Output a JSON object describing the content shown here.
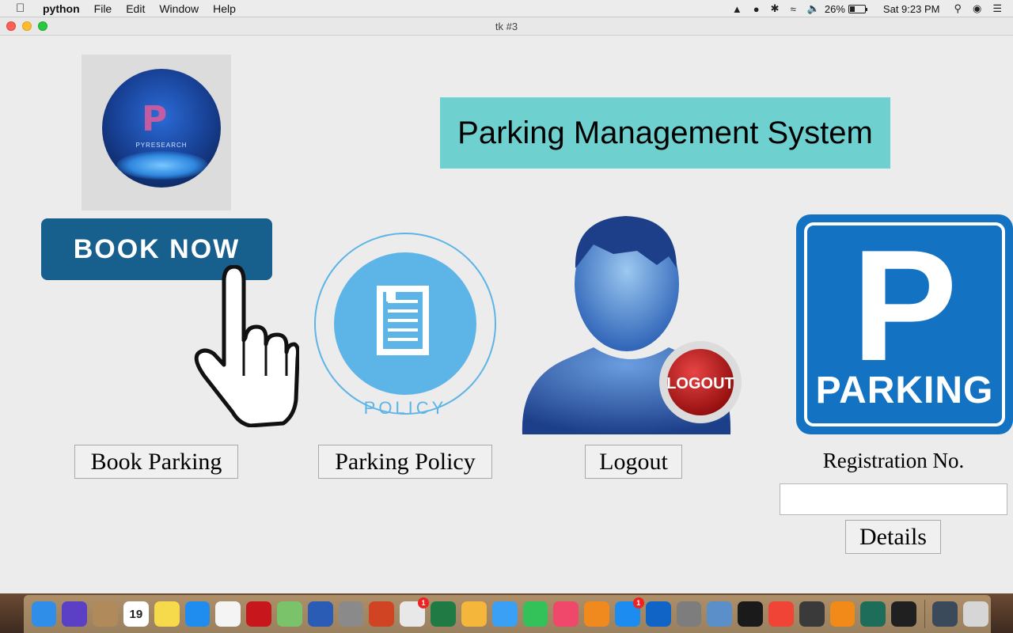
{
  "menubar": {
    "app_name": "python",
    "items": [
      "File",
      "Edit",
      "Window",
      "Help"
    ],
    "battery_percent": "26%",
    "clock": "Sat 9:23 PM"
  },
  "window": {
    "title": "tk #3"
  },
  "main": {
    "title": "Parking Management System",
    "logo_text": "PYRESEARCH",
    "book_now_label": "BOOK NOW",
    "policy_icon_text": "POLICY",
    "logout_badge_text": "LOGOUT",
    "parking_sign_text": "PARKING",
    "parking_sign_letter": "P",
    "buttons": {
      "book_parking": "Book Parking",
      "parking_policy": "Parking Policy",
      "logout": "Logout",
      "details": "Details"
    },
    "registration_label": "Registration No.",
    "registration_value": ""
  },
  "dock": {
    "calendar_day": "19",
    "appstore_badge": "1",
    "chrome_badge": "1",
    "icons": [
      {
        "name": "finder-icon",
        "color": "#2f8fe8"
      },
      {
        "name": "siri-icon",
        "color": "#5b3fc4"
      },
      {
        "name": "contacts-icon",
        "color": "#b08a5a"
      },
      {
        "name": "calendar-icon",
        "color": "#ffffff"
      },
      {
        "name": "notes-icon",
        "color": "#f7d94c"
      },
      {
        "name": "safari-icon",
        "color": "#1f8df0"
      },
      {
        "name": "reminders-icon",
        "color": "#f4f4f4"
      },
      {
        "name": "acrobat-icon",
        "color": "#c8161d"
      },
      {
        "name": "maps-icon",
        "color": "#7bc36a"
      },
      {
        "name": "word-icon",
        "color": "#2b5cb5"
      },
      {
        "name": "launchpad-icon",
        "color": "#8a8a8a"
      },
      {
        "name": "powerpoint-icon",
        "color": "#d04423"
      },
      {
        "name": "chrome-icon",
        "color": "#e8e8e8"
      },
      {
        "name": "excel-icon",
        "color": "#1f7a44"
      },
      {
        "name": "photos-icon",
        "color": "#f5b63c"
      },
      {
        "name": "messages-icon",
        "color": "#3aa0f5"
      },
      {
        "name": "facetime-icon",
        "color": "#33c15a"
      },
      {
        "name": "music-icon",
        "color": "#f0486a"
      },
      {
        "name": "books-icon",
        "color": "#f08a1e"
      },
      {
        "name": "appstore-icon",
        "color": "#1c8cf0"
      },
      {
        "name": "outlook-icon",
        "color": "#0f64c5"
      },
      {
        "name": "system-preferences-icon",
        "color": "#7d7d7d"
      },
      {
        "name": "preview-icon",
        "color": "#5b8fc9"
      },
      {
        "name": "terminal-icon",
        "color": "#1a1a1a"
      },
      {
        "name": "anydesk-icon",
        "color": "#ef4436"
      },
      {
        "name": "sublime-icon",
        "color": "#3a3a3a"
      },
      {
        "name": "vlc-icon",
        "color": "#f28a1a"
      },
      {
        "name": "filmora-icon",
        "color": "#1e6c5a"
      },
      {
        "name": "exec-icon",
        "color": "#202020"
      },
      {
        "name": "screen-icon",
        "color": "#3a4a5a"
      },
      {
        "name": "trash-icon",
        "color": "#d6d6d6"
      }
    ]
  }
}
